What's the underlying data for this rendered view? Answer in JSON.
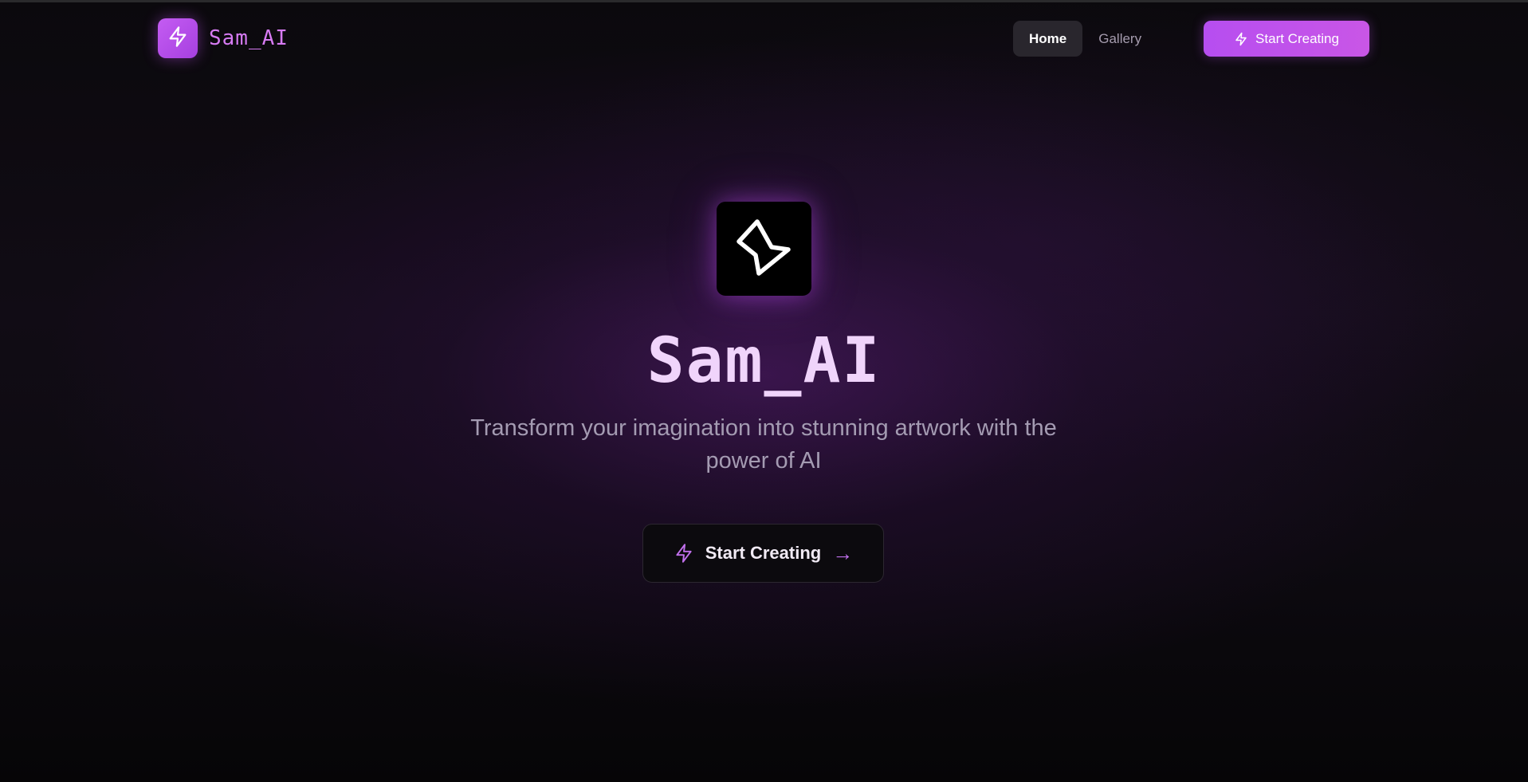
{
  "colors": {
    "accent": "#c45cf2",
    "brand_text": "#d77bf3",
    "title": "#f0d4fb",
    "subtitle": "#a49bb2",
    "background": "#060507"
  },
  "navbar": {
    "brand_icon": "lightning-icon",
    "brand_name": "Sam_AI",
    "links": [
      {
        "label": "Home",
        "active": true
      },
      {
        "label": "Gallery",
        "active": false
      }
    ],
    "cta": {
      "icon": "lightning-icon",
      "label": "Start Creating"
    }
  },
  "hero": {
    "logo_icon": "lightning-icon",
    "title": "Sam_AI",
    "subtitle": "Transform your imagination into stunning artwork with the power of AI",
    "cta": {
      "icon": "lightning-icon",
      "label": "Start Creating",
      "arrow": "→"
    }
  }
}
